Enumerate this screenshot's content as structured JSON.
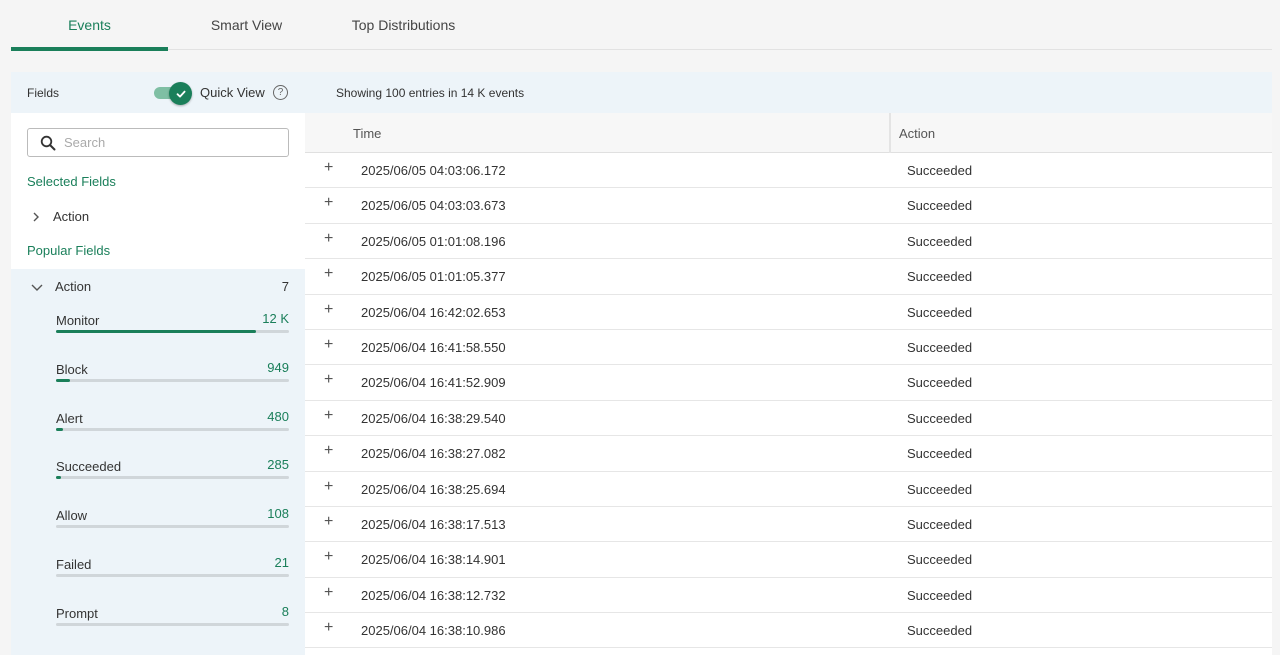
{
  "tabs": [
    {
      "label": "Events",
      "active": true
    },
    {
      "label": "Smart View",
      "active": false
    },
    {
      "label": "Top Distributions",
      "active": false
    }
  ],
  "left": {
    "fields_label": "Fields",
    "quick_view_label": "Quick View",
    "quick_view_on": true,
    "help_glyph": "?",
    "search_placeholder": "Search",
    "selected_title": "Selected Fields",
    "selected_fields": [
      "Action"
    ],
    "popular_title": "Popular Fields",
    "popular_field": {
      "name": "Action",
      "count": "7",
      "values": [
        {
          "name": "Monitor",
          "count": "12 K",
          "fraction": 0.86
        },
        {
          "name": "Block",
          "count": "949",
          "fraction": 0.06
        },
        {
          "name": "Alert",
          "count": "480",
          "fraction": 0.03
        },
        {
          "name": "Succeeded",
          "count": "285",
          "fraction": 0.02
        },
        {
          "name": "Allow",
          "count": "108",
          "fraction": 0.0
        },
        {
          "name": "Failed",
          "count": "21",
          "fraction": 0.0
        },
        {
          "name": "Prompt",
          "count": "8",
          "fraction": 0.0
        }
      ]
    }
  },
  "right": {
    "summary": "Showing 100 entries in 14 K events",
    "columns": {
      "time": "Time",
      "action": "Action"
    },
    "rows": [
      {
        "time": "2025/06/05 04:03:06.172",
        "action": "Succeeded"
      },
      {
        "time": "2025/06/05 04:03:03.673",
        "action": "Succeeded"
      },
      {
        "time": "2025/06/05 01:01:08.196",
        "action": "Succeeded"
      },
      {
        "time": "2025/06/05 01:01:05.377",
        "action": "Succeeded"
      },
      {
        "time": "2025/06/04 16:42:02.653",
        "action": "Succeeded"
      },
      {
        "time": "2025/06/04 16:41:58.550",
        "action": "Succeeded"
      },
      {
        "time": "2025/06/04 16:41:52.909",
        "action": "Succeeded"
      },
      {
        "time": "2025/06/04 16:38:29.540",
        "action": "Succeeded"
      },
      {
        "time": "2025/06/04 16:38:27.082",
        "action": "Succeeded"
      },
      {
        "time": "2025/06/04 16:38:25.694",
        "action": "Succeeded"
      },
      {
        "time": "2025/06/04 16:38:17.513",
        "action": "Succeeded"
      },
      {
        "time": "2025/06/04 16:38:14.901",
        "action": "Succeeded"
      },
      {
        "time": "2025/06/04 16:38:12.732",
        "action": "Succeeded"
      },
      {
        "time": "2025/06/04 16:38:10.986",
        "action": "Succeeded"
      }
    ]
  },
  "colors": {
    "accent": "#1a7f5a",
    "panel_header": "#edf4f9"
  }
}
